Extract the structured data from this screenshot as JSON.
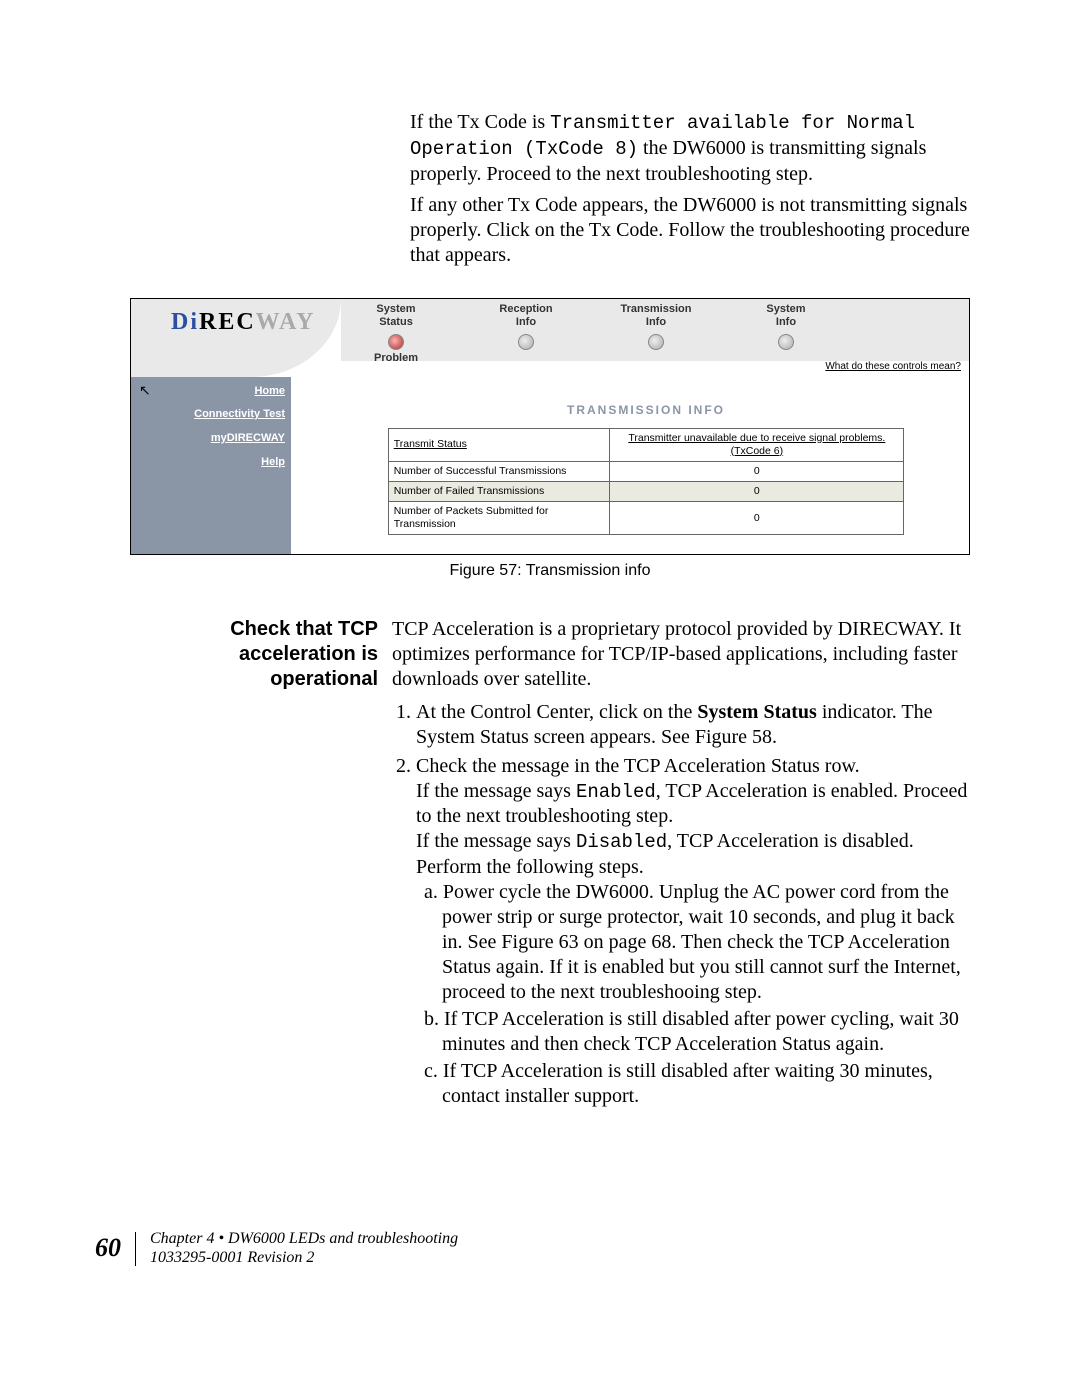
{
  "intro": {
    "p1_pre": "If the Tx Code is ",
    "p1_code": "Transmitter available for Normal Operation (TxCode 8)",
    "p1_post": " the DW6000 is transmitting signals properly. Proceed to the next troubleshooting step.",
    "p2": "If any other Tx Code appears, the DW6000 is not transmitting signals properly. Click on the Tx Code. Follow the troubleshooting procedure that appears."
  },
  "figure": {
    "brand_di": "Di",
    "brand_rec": "REC",
    "brand_way": "WAY",
    "tabs": [
      {
        "line1": "System",
        "line2": "Status",
        "below": "Problem",
        "dot": "problem"
      },
      {
        "line1": "Reception",
        "line2": "Info",
        "below": "",
        "dot": "plain"
      },
      {
        "line1": "Transmission",
        "line2": "Info",
        "below": "",
        "dot": "plain"
      },
      {
        "line1": "System",
        "line2": "Info",
        "below": "",
        "dot": "plain"
      }
    ],
    "controls_link": "What do these controls mean?",
    "sidebar": [
      "Home",
      "Connectivity Test",
      "myDIRECWAY",
      "Help"
    ],
    "section_title": "TRANSMISSION INFO",
    "rows": [
      {
        "label": "Transmit Status",
        "value": "Transmitter unavailable due to receive signal problems. (TxCode 6)",
        "link": true,
        "shade": false,
        "labelLink": true
      },
      {
        "label": "Number of Successful Transmissions",
        "value": "0",
        "link": false,
        "shade": false,
        "labelLink": false
      },
      {
        "label": "Number of Failed Transmissions",
        "value": "0",
        "link": false,
        "shade": true,
        "labelLink": false
      },
      {
        "label": "Number of Packets Submitted for Transmission",
        "value": "0",
        "link": false,
        "shade": false,
        "labelLink": false
      }
    ],
    "caption": "Figure 57:  Transmission info"
  },
  "section2": {
    "heading": "Check that TCP acceleration is operational",
    "intro": "TCP Acceleration is a proprietary protocol provided by DIRECWAY. It optimizes performance for TCP/IP-based applications, including faster downloads over satellite.",
    "step1_pre": "At the Control Center, click on the ",
    "step1_bold": "System Status",
    "step1_post": " indicator. The System Status screen appears. See Figure 58.",
    "step2": "Check the message in the TCP Acceleration Status row.",
    "step2_en_pre": "If the message says ",
    "step2_en_code": "Enabled",
    "step2_en_post": ", TCP Acceleration is enabled. Proceed to the next troubleshooting step.",
    "step2_dis_pre": "If the message says ",
    "step2_dis_code": "Disabled",
    "step2_dis_post": ", TCP Acceleration is disabled. Perform the following steps.",
    "sub_a": "a. Power cycle the DW6000. Unplug the AC power cord from the power strip or surge protector, wait 10 seconds, and plug it back in. See Figure 63 on page 68. Then check the TCP Acceleration Status again. If it is enabled but you still cannot surf the Internet, proceed to the next troubleshooing step.",
    "sub_b": "b. If TCP Acceleration is still disabled after power cycling, wait 30 minutes and then check TCP Acceleration Status again.",
    "sub_c": "c. If TCP Acceleration is still disabled after waiting 30 minutes, contact installer support."
  },
  "footer": {
    "page": "60",
    "chapter": "Chapter 4 • DW6000 LEDs and troubleshooting",
    "revision": "1033295-0001  Revision 2"
  }
}
